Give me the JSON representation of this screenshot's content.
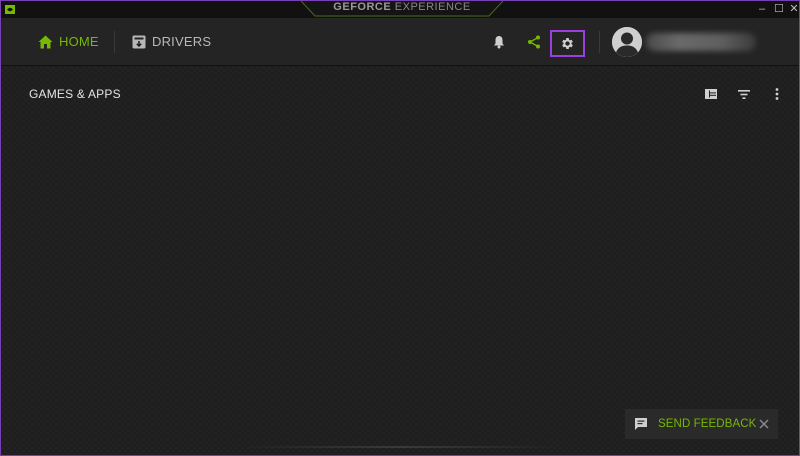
{
  "window": {
    "title_bold": "GEFORCE",
    "title_light": "EXPERIENCE",
    "controls": [
      "minimize",
      "maximize",
      "close"
    ],
    "minimize_glyph": "–",
    "maximize_glyph": "☐",
    "close_glyph": "✕"
  },
  "nav": {
    "home_label": "HOME",
    "drivers_label": "DRIVERS",
    "active_tab": "HOME",
    "icons": [
      "home-icon",
      "drivers-icon",
      "bell-icon",
      "share-icon",
      "gear-icon",
      "avatar"
    ]
  },
  "main": {
    "section_title": "GAMES & APPS",
    "tools": [
      "grid-view-icon",
      "filter-icon",
      "more-options-icon"
    ]
  },
  "feedback": {
    "label": "SEND FEEDBACK"
  },
  "colors": {
    "accent": "#76b900",
    "highlight_border": "#9b3fe0",
    "background": "#1c1c1c",
    "nav_background": "#242424"
  }
}
